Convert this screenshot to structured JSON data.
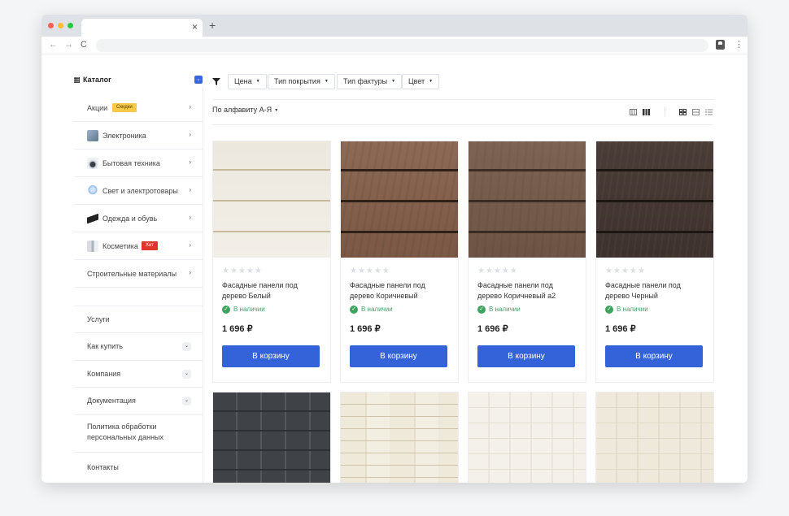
{
  "browser": {
    "tab_close": "×",
    "new_tab": "+",
    "back": "←",
    "forward": "→",
    "reload": "C",
    "menu": "⋮"
  },
  "sidebar": {
    "catalog_title": "Каталог",
    "catalog_toggle": "⌄",
    "categories": [
      {
        "label": "Акции",
        "badge": "Скидки",
        "icon": "none"
      },
      {
        "label": "Электроника",
        "icon": "electronics-icon"
      },
      {
        "label": "Бытовая техника",
        "icon": "appliance-icon"
      },
      {
        "label": "Свет и электротовары",
        "icon": "lightbulb-icon"
      },
      {
        "label": "Одежда и обувь",
        "icon": "boot-icon"
      },
      {
        "label": "Косметика",
        "badge": "Хит",
        "icon": "cosmetics-icon"
      },
      {
        "label": "Строительные материалы",
        "icon": "none"
      }
    ],
    "arrow": "›",
    "sections": [
      {
        "label": "Услуги",
        "expandable": false
      },
      {
        "label": "Как купить",
        "expandable": true
      },
      {
        "label": "Компания",
        "expandable": true
      },
      {
        "label": "Документация",
        "expandable": true
      },
      {
        "label": "Политика обработки персональных данных",
        "line1": "Политика обработки",
        "line2": "персональных данных",
        "expandable": false
      },
      {
        "label": "Контакты",
        "expandable": false
      }
    ],
    "chevron": "⌄"
  },
  "filters": {
    "items": [
      "Цена",
      "Тип покрытия",
      "Тип фактуры",
      "Цвет"
    ],
    "caret": "▼",
    "sort_label": "По алфавиту А-Я"
  },
  "products": [
    {
      "name": "Фасадные панели под дерево Белый",
      "stock": "В наличии",
      "price": "1 696 ₽",
      "button": "В корзину",
      "texture": "siding-white"
    },
    {
      "name": "Фасадные панели под дерево Коричневый",
      "stock": "В наличии",
      "price": "1 696 ₽",
      "button": "В корзину",
      "texture": "siding-brown"
    },
    {
      "name": "Фасадные панели под дерево Коричневый а2",
      "stock": "В наличии",
      "price": "1 696 ₽",
      "button": "В корзину",
      "texture": "siding-brown2"
    },
    {
      "name": "Фасадные панели под дерево Черный",
      "stock": "В наличии",
      "price": "1 696 ₽",
      "button": "В корзину",
      "texture": "siding-black"
    }
  ],
  "products_row2": [
    {
      "texture": "tex-dark"
    },
    {
      "texture": "tex-stone"
    },
    {
      "texture": "tex-cream"
    },
    {
      "texture": "tex-cream2"
    }
  ],
  "stars": "★★★★★",
  "check": "✓",
  "colors": {
    "accent": "#3462d9",
    "in_stock": "#3ea35f",
    "badge_sale": "#f7c948",
    "badge_hit": "#e0352b"
  }
}
